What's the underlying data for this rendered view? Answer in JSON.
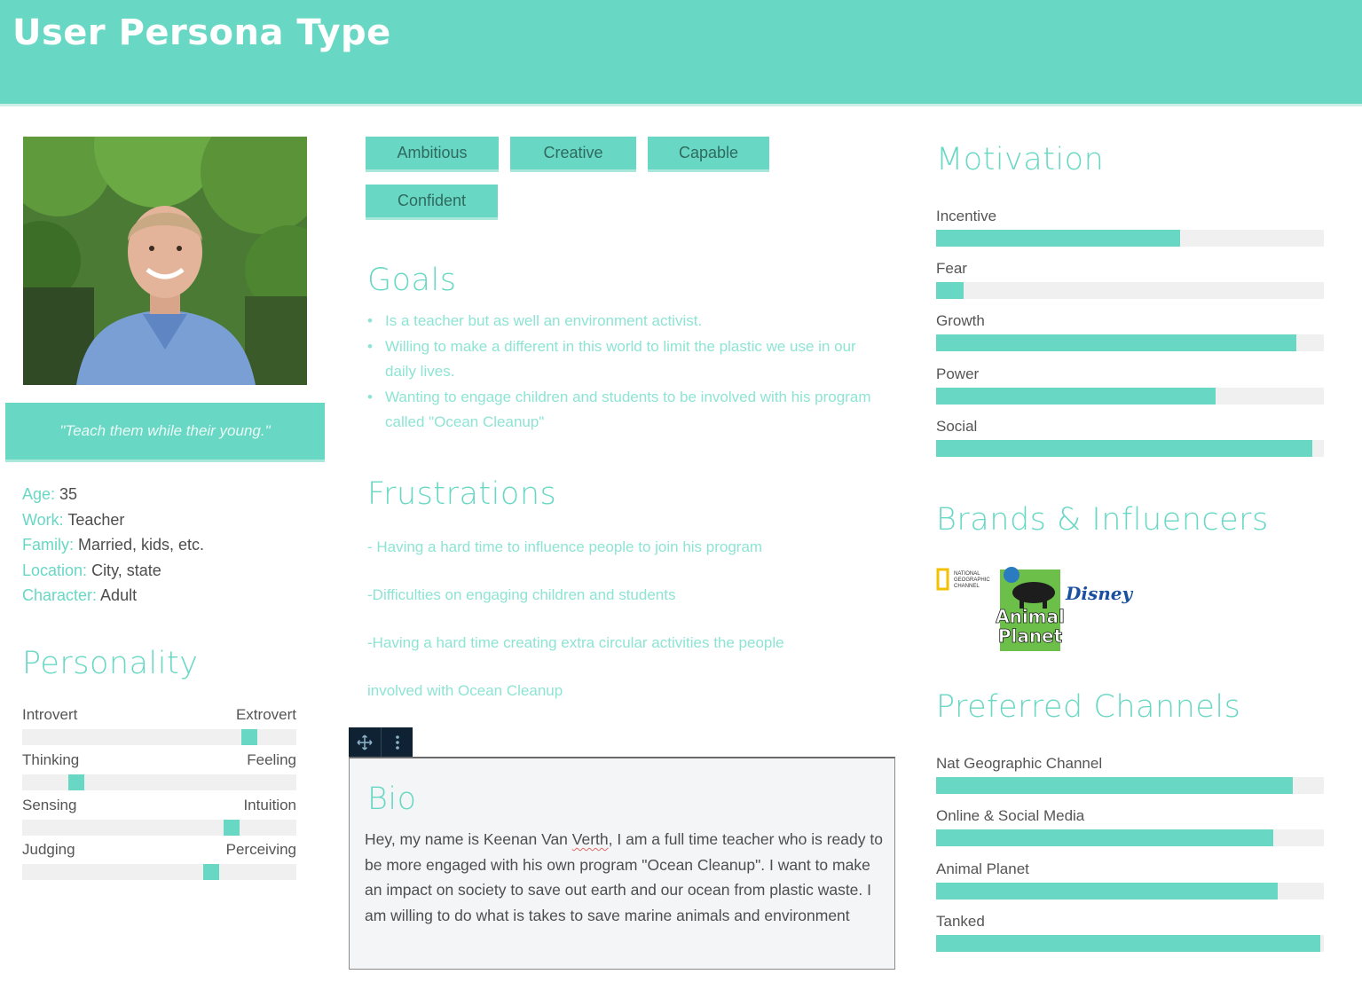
{
  "header": {
    "title": "User Persona Type"
  },
  "persona": {
    "quote": "\"Teach them while their young.\"",
    "facts": [
      {
        "key": "Age:",
        "value": " 35"
      },
      {
        "key": "Work:",
        "value": " Teacher"
      },
      {
        "key": "Family:",
        "value": " Married, kids, etc."
      },
      {
        "key": "Location:",
        "value": " City, state"
      },
      {
        "key": "Character:",
        "value": " Adult"
      }
    ]
  },
  "personality": {
    "title": "Personality",
    "rows": [
      {
        "left": "Introvert",
        "right": "Extrovert",
        "position": 0.85
      },
      {
        "left": "Thinking",
        "right": "Feeling",
        "position": 0.18
      },
      {
        "left": "Sensing",
        "right": "Intuition",
        "position": 0.78
      },
      {
        "left": "Judging",
        "right": "Perceiving",
        "position": 0.7
      }
    ]
  },
  "traits": [
    "Ambitious",
    "Creative",
    "Capable",
    "Confident"
  ],
  "goals": {
    "title": "Goals",
    "items": [
      "Is a teacher but as well an environment activist.",
      "Willing to make a different in this world to limit the plastic we use in our daily lives.",
      "Wanting to engage children and students to be involved with his program called \"Ocean Cleanup\""
    ]
  },
  "frustrations": {
    "title": "Frustrations",
    "items": [
      "- Having a hard time to influence people to join his program",
      "-Difficulties on engaging children and students",
      "-Having a hard time creating extra circular activities the people",
      "involved with Ocean Cleanup"
    ]
  },
  "bio": {
    "title": "Bio",
    "text_before": "Hey, my name is Keenan Van ",
    "text_misspelled": "Verth",
    "text_after": ", I am a full time teacher who is ready to be more engaged with his own program \"Ocean Cleanup\". I want to make an impact on society to save out earth and our ocean from plastic waste. I am willing to do what is takes to save marine animals and environment",
    "toolbar": {
      "move_icon": "move-icon",
      "more_icon": "more-vertical-icon"
    }
  },
  "motivation": {
    "title": "Motivation",
    "items": [
      {
        "label": "Incentive",
        "value": 0.63
      },
      {
        "label": "Fear",
        "value": 0.07
      },
      {
        "label": "Growth",
        "value": 0.93
      },
      {
        "label": "Power",
        "value": 0.72
      },
      {
        "label": "Social",
        "value": 0.97
      }
    ]
  },
  "brands": {
    "title": "Brands & Influencers",
    "logos": [
      {
        "name": "national-geographic-logo",
        "lines": [
          "NATIONAL",
          "GEOGRAPHIC",
          "CHANNEL"
        ]
      },
      {
        "name": "animal-planet-logo",
        "lines": [
          "Animal",
          "Planet"
        ]
      },
      {
        "name": "disney-logo",
        "lines": [
          "Disney"
        ]
      }
    ]
  },
  "channels": {
    "title": "Preferred Channels",
    "items": [
      {
        "label": "Nat Geographic Channel",
        "value": 0.92
      },
      {
        "label": "Online & Social Media",
        "value": 0.87
      },
      {
        "label": "Animal Planet",
        "value": 0.88
      },
      {
        "label": "Tanked",
        "value": 0.99
      }
    ]
  },
  "colors": {
    "accent": "#68d8c4",
    "track": "#f0f0f0"
  }
}
